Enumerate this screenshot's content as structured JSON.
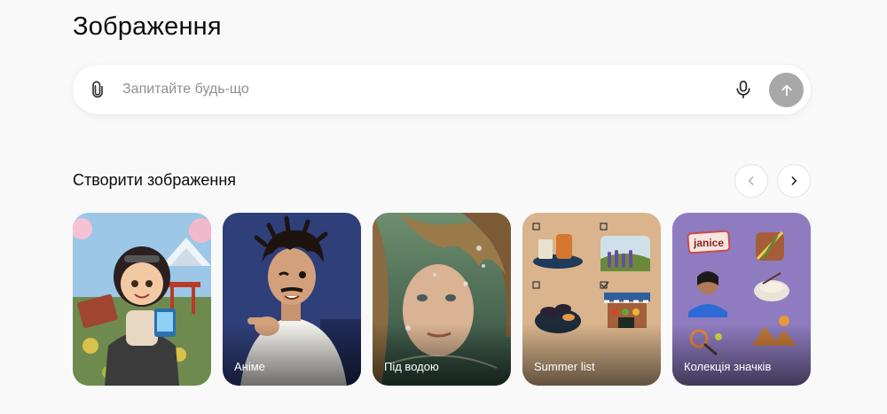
{
  "page": {
    "title": "Зображення"
  },
  "composer": {
    "placeholder": "Запитайте будь-що",
    "attach_icon": "paperclip-icon",
    "mic_icon": "microphone-icon",
    "send_icon": "arrow-up-icon"
  },
  "section": {
    "title": "Створити зображення",
    "prev_icon": "chevron-left-icon",
    "next_icon": "chevron-right-icon"
  },
  "cards": [
    {
      "label": "",
      "style": "chibi-adventurer"
    },
    {
      "label": "Аніме",
      "style": "anime"
    },
    {
      "label": "Під водою",
      "style": "underwater"
    },
    {
      "label": "Summer list",
      "style": "summer-list"
    },
    {
      "label": "Колекція значків",
      "style": "badge-collection"
    }
  ],
  "badge_card": {
    "name_tag": "janice"
  },
  "colors": {
    "background": "#f9f9f9",
    "send_button": "#a8a8a8",
    "summer_bg": "#d9b48c",
    "badge_bg": "#8f7cc0",
    "anime_bg": "#2f3f7a"
  }
}
